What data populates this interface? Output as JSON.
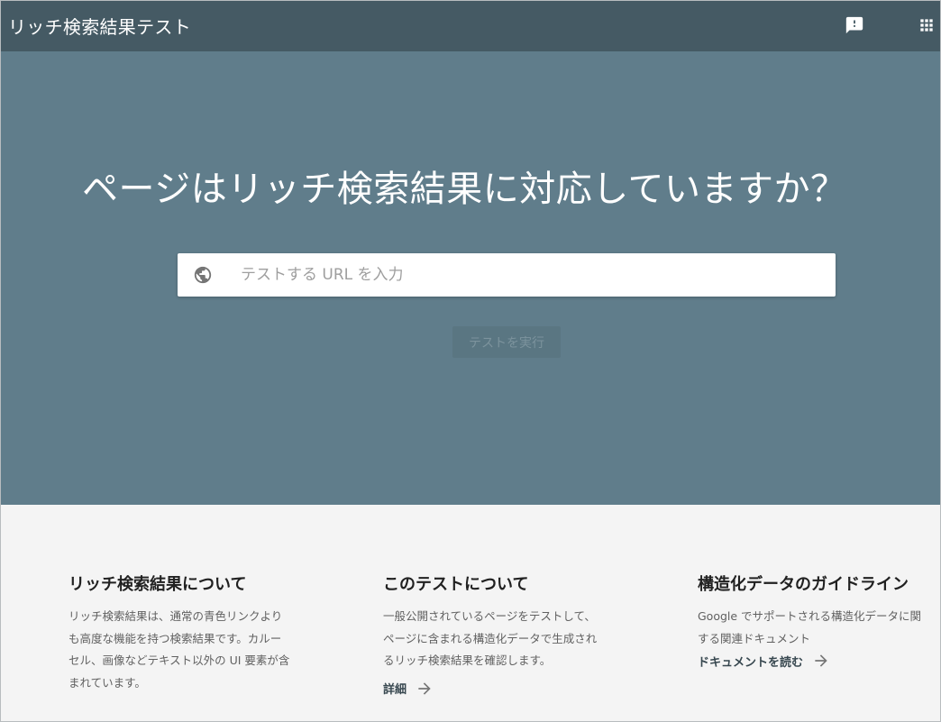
{
  "header": {
    "title": "リッチ検索結果テスト",
    "icons": [
      "feedback-icon",
      "apps-icon"
    ]
  },
  "hero": {
    "headline": "ページはリッチ検索結果に対応していますか？",
    "search": {
      "icon": "globe-icon",
      "placeholder": "テストする URL を入力",
      "value": ""
    },
    "run_button_label": "テストを実行"
  },
  "info": {
    "cards": [
      {
        "title": "リッチ検索結果について",
        "lines": [
          "リッチ検索結果は、通常の青色リンクより",
          "も高度な機能を持つ検索結果です。カルー",
          "セル、画像などテキスト以外の UI 要素が含",
          "まれています。"
        ],
        "link": ""
      },
      {
        "title": "このテストについて",
        "lines": [
          "一般公開されているページをテストして、",
          "ページに含まれる構造化データで生成され",
          "るリッチ検索結果を確認します。"
        ],
        "link": "詳細"
      },
      {
        "title": "構造化データのガイドライン",
        "lines": [
          "Google でサポートされる構造化データに関",
          "する関連ドキュメント"
        ],
        "link": "ドキュメントを読む"
      }
    ]
  },
  "colors": {
    "topbar": "#455a64",
    "hero": "#607d8b",
    "info_background": "#f4f4f4",
    "run_button": "#5a7682"
  }
}
